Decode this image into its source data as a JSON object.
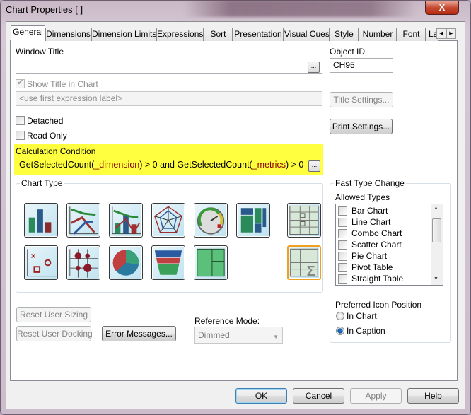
{
  "window": {
    "title": "Chart Properties [ ]",
    "close_label": "X"
  },
  "tabs": [
    "General",
    "Dimensions",
    "Dimension Limits",
    "Expressions",
    "Sort",
    "Presentation",
    "Visual Cues",
    "Style",
    "Number",
    "Font",
    "La"
  ],
  "general": {
    "window_title": {
      "label": "Window Title",
      "value": "",
      "ellipsis": "..."
    },
    "object_id": {
      "label": "Object ID",
      "value": "CH95"
    },
    "show_title": {
      "label": "Show Title in Chart",
      "checked": true,
      "disabled": true
    },
    "title_placeholder": "<use first expression label>",
    "title_settings": "Title Settings...",
    "print_settings": "Print Settings...",
    "detached": {
      "label": "Detached",
      "checked": false
    },
    "read_only": {
      "label": "Read Only",
      "checked": false
    },
    "calc_condition": {
      "label": "Calculation Condition",
      "parts": [
        "GetSelectedCount(",
        "_dimension",
        ") > 0 and GetSelectedCount(",
        "_metrics",
        ") > 0"
      ],
      "ellipsis": "...",
      "highlight": "#ffff40",
      "variable_color": "#8b0000"
    },
    "chart_type": {
      "label": "Chart Type",
      "icons": [
        "bar-chart",
        "line-chart",
        "combo-chart",
        "radar-chart",
        "gauge-chart",
        "mekko-chart",
        "pivot-table",
        "scatter-chart",
        "grid-chart",
        "pie-chart",
        "funnel-chart",
        "block-chart",
        "straight-table"
      ],
      "selected": "straight-table"
    },
    "fast_type_change": {
      "label": "Fast Type Change",
      "allowed_label": "Allowed Types",
      "types": [
        "Bar Chart",
        "Line Chart",
        "Combo Chart",
        "Scatter Chart",
        "Pie Chart",
        "Pivot Table",
        "Straight Table"
      ],
      "icon_position_label": "Preferred Icon Position",
      "positions": [
        "In Chart",
        "In Caption"
      ],
      "selected_position": "In Caption"
    },
    "reset_sizing": "Reset User Sizing",
    "reset_docking": "Reset User Docking",
    "error_messages": "Error Messages...",
    "reference_mode": {
      "label": "Reference Mode:",
      "value": "Dimmed"
    }
  },
  "footer": {
    "ok": "OK",
    "cancel": "Cancel",
    "apply": "Apply",
    "help": "Help"
  }
}
